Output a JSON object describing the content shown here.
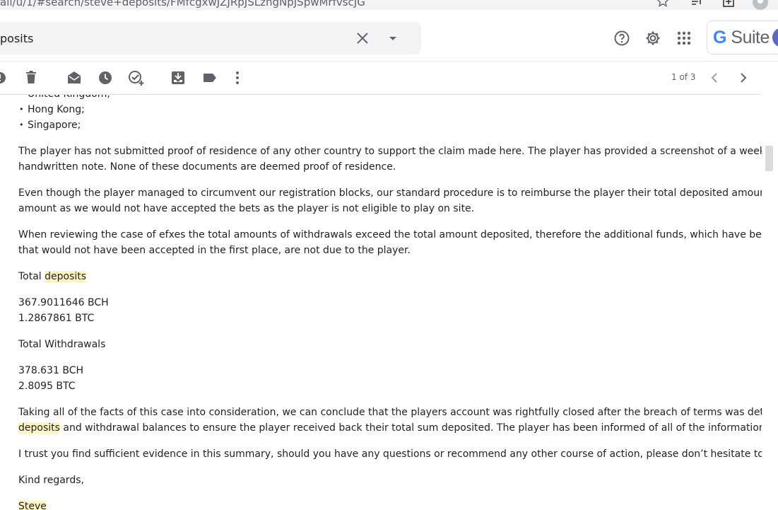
{
  "browser": {
    "url": "ail/u/1/#search/steve+deposits/FMfcgxwJZJRpJSLzngNpJSpwMrfvscJG"
  },
  "search": {
    "query": "posits"
  },
  "gsuite": {
    "logo_g": "G",
    "logo_text": " Suite"
  },
  "pager": {
    "label": "1 of 3"
  },
  "email": {
    "partial_top": "United Kingdom;",
    "bullets": [
      "Hong Kong;",
      "Singapore;"
    ],
    "p1_line1": "The player has not submitted proof of residence of any other country to support the claim made here. The player has provided a screenshot of a week’s visit",
    "p1_line2": "handwritten note. None of these documents are deemed proof of residence.",
    "p2_line1": "Even though the player managed to circumvent our registration blocks, our standard procedure is to reimburse the player their total deposited amount. We",
    "p2_line2": "amount as we would not have accepted the bets as the player is not eligible to play on site.",
    "p3_line1": "When reviewing the case of efxes the total amounts of withdrawals exceed the total amount deposited, therefore the additional funds, which have been accrued",
    "p3_line2": "that would not have been accepted in the first place, are not due to the player.",
    "deposits_prefix": "Total ",
    "deposits_word": "deposits",
    "deposit_bch": "367.9011646 BCH",
    "deposit_btc": "1.2867861 BTC",
    "withdrawals_heading": "Total Withdrawals",
    "withdraw_bch": "378.631 BCH",
    "withdraw_btc": "2.8095 BTC",
    "p4_line1": "Taking all of the facts of this case into consideration, we can conclude that the players account was rightfully closed after the breach of terms was detected",
    "p4_line2_word": "deposits",
    "p4_line2_rest": " and withdrawal balances to ensure the player received back their total sum deposited. The player has been informed of all of the information above",
    "p5": "I trust you find sufficient evidence in this summary, should you have any questions or recommend any other course of action, please don’t hesitate to get in",
    "closing": "Kind regards,",
    "signature": "Steve"
  },
  "colors": {
    "highlight": "#fdf6c3",
    "icon": "#5f6368",
    "gsuite_blue": "#4285f4"
  }
}
